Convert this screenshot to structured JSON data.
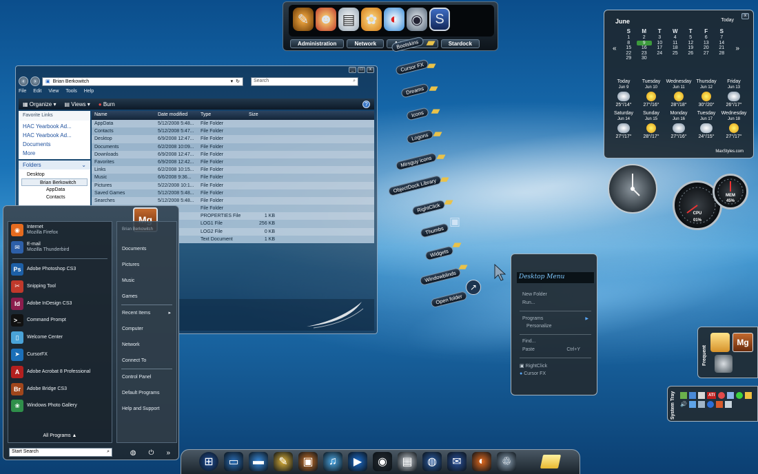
{
  "top_dock": {
    "tabs": [
      "Administration",
      "Network",
      "Ad",
      "Stardock"
    ],
    "icons": [
      "pen-tool-icon",
      "users-icon",
      "documents-icon",
      "palette-icon",
      "color-ring-icon",
      "disc-icon",
      "stardock-icon"
    ]
  },
  "folder_fan": {
    "items": [
      "Bootskins",
      "Cursor FX",
      "Dreams",
      "Icons",
      "Logons",
      "Mirsguy icons",
      "ObjectDock Library",
      "RightClick",
      "Thumbs",
      "Widgets",
      "Windowblinds",
      "Open folder"
    ]
  },
  "explorer": {
    "address": "Brian Berkowitch",
    "search_placeholder": "Search",
    "menu": [
      "File",
      "Edit",
      "View",
      "Tools",
      "Help"
    ],
    "toolbar": {
      "organize": "Organize",
      "views": "Views",
      "burn": "Burn"
    },
    "favorite_links_title": "Favorite Links",
    "favorite_links": [
      "HAC Yearbook Ad...",
      "HAC Yearbook Ad...",
      "Documents",
      "More"
    ],
    "folders_title": "Folders",
    "tree": [
      "Desktop",
      "Brian Berkowitch",
      "AppData",
      "Contacts"
    ],
    "columns": [
      "Name",
      "Date modified",
      "Type",
      "Size"
    ],
    "files": [
      [
        "AppData",
        "5/12/2008 5:48...",
        "File Folder",
        ""
      ],
      [
        "Contacts",
        "5/12/2008 5:47...",
        "File Folder",
        ""
      ],
      [
        "Desktop",
        "6/9/2008 12:47...",
        "File Folder",
        ""
      ],
      [
        "Documents",
        "6/2/2008 10:09...",
        "File Folder",
        ""
      ],
      [
        "Downloads",
        "6/9/2008 12:47...",
        "File Folder",
        ""
      ],
      [
        "Favorites",
        "6/9/2008 12:42...",
        "File Folder",
        ""
      ],
      [
        "Links",
        "6/2/2008 10:15...",
        "File Folder",
        ""
      ],
      [
        "Music",
        "6/6/2008 9:36...",
        "File Folder",
        ""
      ],
      [
        "Pictures",
        "5/22/2008 10:1...",
        "File Folder",
        ""
      ],
      [
        "Saved Games",
        "5/12/2008 5:48...",
        "File Folder",
        ""
      ],
      [
        "Searches",
        "5/12/2008 5:48...",
        "File Folder",
        ""
      ],
      [
        "",
        "...5:48...",
        "File Folder",
        ""
      ],
      [
        "",
        "...3:26...",
        "PROPERTIES File",
        "1 KB"
      ],
      [
        "",
        "...2:55...",
        "LOG1 File",
        "256 KB"
      ],
      [
        "",
        "...2:55...",
        "LOG2 File",
        "0 KB"
      ],
      [
        "",
        "...3:31...",
        "Text Document",
        "1 KB"
      ]
    ]
  },
  "start_menu": {
    "user_name": "Brian Berkowitch",
    "user_avatar": "Mg",
    "programs": [
      {
        "title": "Internet",
        "sub": "Mozilla Firefox",
        "badge": "◉",
        "color": "#e56b1f"
      },
      {
        "title": "E-mail",
        "sub": "Mozilla Thunderbird",
        "badge": "✉",
        "color": "#2d5fa8"
      },
      {
        "title": "Adobe Photoshop CS3",
        "sub": "",
        "badge": "Ps",
        "color": "#1d5fa6"
      },
      {
        "title": "Snipping Tool",
        "sub": "",
        "badge": "✂",
        "color": "#c0392b"
      },
      {
        "title": "Adobe InDesign CS3",
        "sub": "",
        "badge": "Id",
        "color": "#8b1d4d"
      },
      {
        "title": "Command Prompt",
        "sub": "",
        "badge": ">_",
        "color": "#111111"
      },
      {
        "title": "Welcome Center",
        "sub": "",
        "badge": "▯",
        "color": "#4aa3d8"
      },
      {
        "title": "CursorFX",
        "sub": "",
        "badge": "➤",
        "color": "#1b6fb8"
      },
      {
        "title": "Adobe Acrobat 8 Professional",
        "sub": "",
        "badge": "A",
        "color": "#b3201f"
      },
      {
        "title": "Adobe Bridge CS3",
        "sub": "",
        "badge": "Br",
        "color": "#a0461c"
      },
      {
        "title": "Windows Photo Gallery",
        "sub": "",
        "badge": "❀",
        "color": "#2f8f4a"
      }
    ],
    "all_programs": "All Programs",
    "right_items": [
      "Documents",
      "Pictures",
      "Music",
      "Games",
      "Recent Items",
      "Computer",
      "Network",
      "Connect To",
      "Control Panel",
      "Default Programs",
      "Help and Support"
    ],
    "search_placeholder": "Start Search"
  },
  "weather": {
    "month": "June",
    "today_label": "Today",
    "weekdays": [
      "S",
      "M",
      "T",
      "W",
      "T",
      "F",
      "S"
    ],
    "weeks": [
      [
        "1",
        "2",
        "3",
        "4",
        "5",
        "6",
        "7"
      ],
      [
        "8",
        "9",
        "10",
        "11",
        "12",
        "13",
        "14"
      ],
      [
        "15",
        "16",
        "17",
        "18",
        "19",
        "20",
        "21"
      ],
      [
        "22",
        "23",
        "24",
        "25",
        "26",
        "27",
        "28"
      ],
      [
        "29",
        "30",
        "",
        "",
        "",
        "",
        ""
      ]
    ],
    "days": [
      {
        "name": "Today",
        "date": "Jun 9",
        "temp": "25°/14°",
        "icon": "storm-icon"
      },
      {
        "name": "Tuesday",
        "date": "Jun 10",
        "temp": "27°/16°",
        "icon": "sun-icon"
      },
      {
        "name": "Wednesday",
        "date": "Jun 11",
        "temp": "28°/18°",
        "icon": "sun-icon"
      },
      {
        "name": "Thursday",
        "date": "Jun 12",
        "temp": "30°/20°",
        "icon": "sun-icon"
      },
      {
        "name": "Friday",
        "date": "Jun 13",
        "temp": "26°/17°",
        "icon": "storm-icon"
      },
      {
        "name": "Saturday",
        "date": "Jun 14",
        "temp": "27°/17°",
        "icon": "storm-icon"
      },
      {
        "name": "Sunday",
        "date": "Jun 15",
        "temp": "28°/17°",
        "icon": "sun-icon"
      },
      {
        "name": "Monday",
        "date": "Jun 16",
        "temp": "27°/16°",
        "icon": "storm-icon"
      },
      {
        "name": "Tuesday",
        "date": "Jun 17",
        "temp": "24°/15°",
        "icon": "cloud-icon"
      },
      {
        "name": "Wednesday",
        "date": "Jun 18",
        "temp": "27°/17°",
        "icon": "sun-icon"
      }
    ],
    "credit": "MaxStyles.com"
  },
  "gauges": {
    "cpu_label": "CPU",
    "cpu_value": "01%",
    "mem_label": "MEM",
    "mem_value": "45%"
  },
  "desktop_menu": {
    "title": "Desktop Menu",
    "items": [
      "New Folder",
      "Run...",
      "Programs",
      "Personalize",
      "Find...",
      "Paste",
      "RightClick",
      "Cursor FX"
    ],
    "paste_shortcut": "Ctrl+Y"
  },
  "frequent": {
    "label": "Frequent"
  },
  "system_tray": {
    "label": "System Tray",
    "ati": "ATI"
  },
  "taskbar": {
    "icons": [
      "start-orb-icon",
      "monitor-icon",
      "desktop-icon",
      "pencil-icon",
      "photo-icon",
      "itunes-icon",
      "media-player-icon",
      "speedometer-icon",
      "printer-icon",
      "globe-icon",
      "thunderbird-icon",
      "firefox-icon",
      "recycle-bin-icon"
    ]
  }
}
